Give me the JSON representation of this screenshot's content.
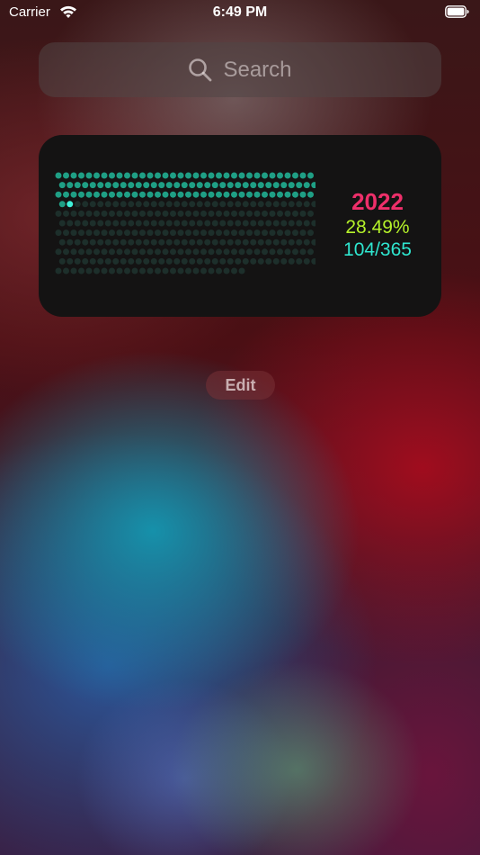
{
  "status_bar": {
    "carrier": "Carrier",
    "time": "6:49 PM",
    "icons": [
      "wifi-icon",
      "battery-icon"
    ]
  },
  "search": {
    "placeholder": "Search",
    "icon": "search-icon"
  },
  "widget": {
    "year": "2022",
    "percent": "28.49%",
    "days": "104/365",
    "colors": {
      "year": "#ee2f6a",
      "percent": "#b5f22a",
      "days": "#2fe6cf",
      "dot_past": "#1f9f85",
      "dot_current": "#3ff0d8",
      "dot_future": "#1d2f2b"
    },
    "dot_grid": {
      "rows": 11,
      "columns": 34,
      "total_days": 365,
      "days_elapsed": 104
    }
  },
  "edit": {
    "label": "Edit"
  }
}
